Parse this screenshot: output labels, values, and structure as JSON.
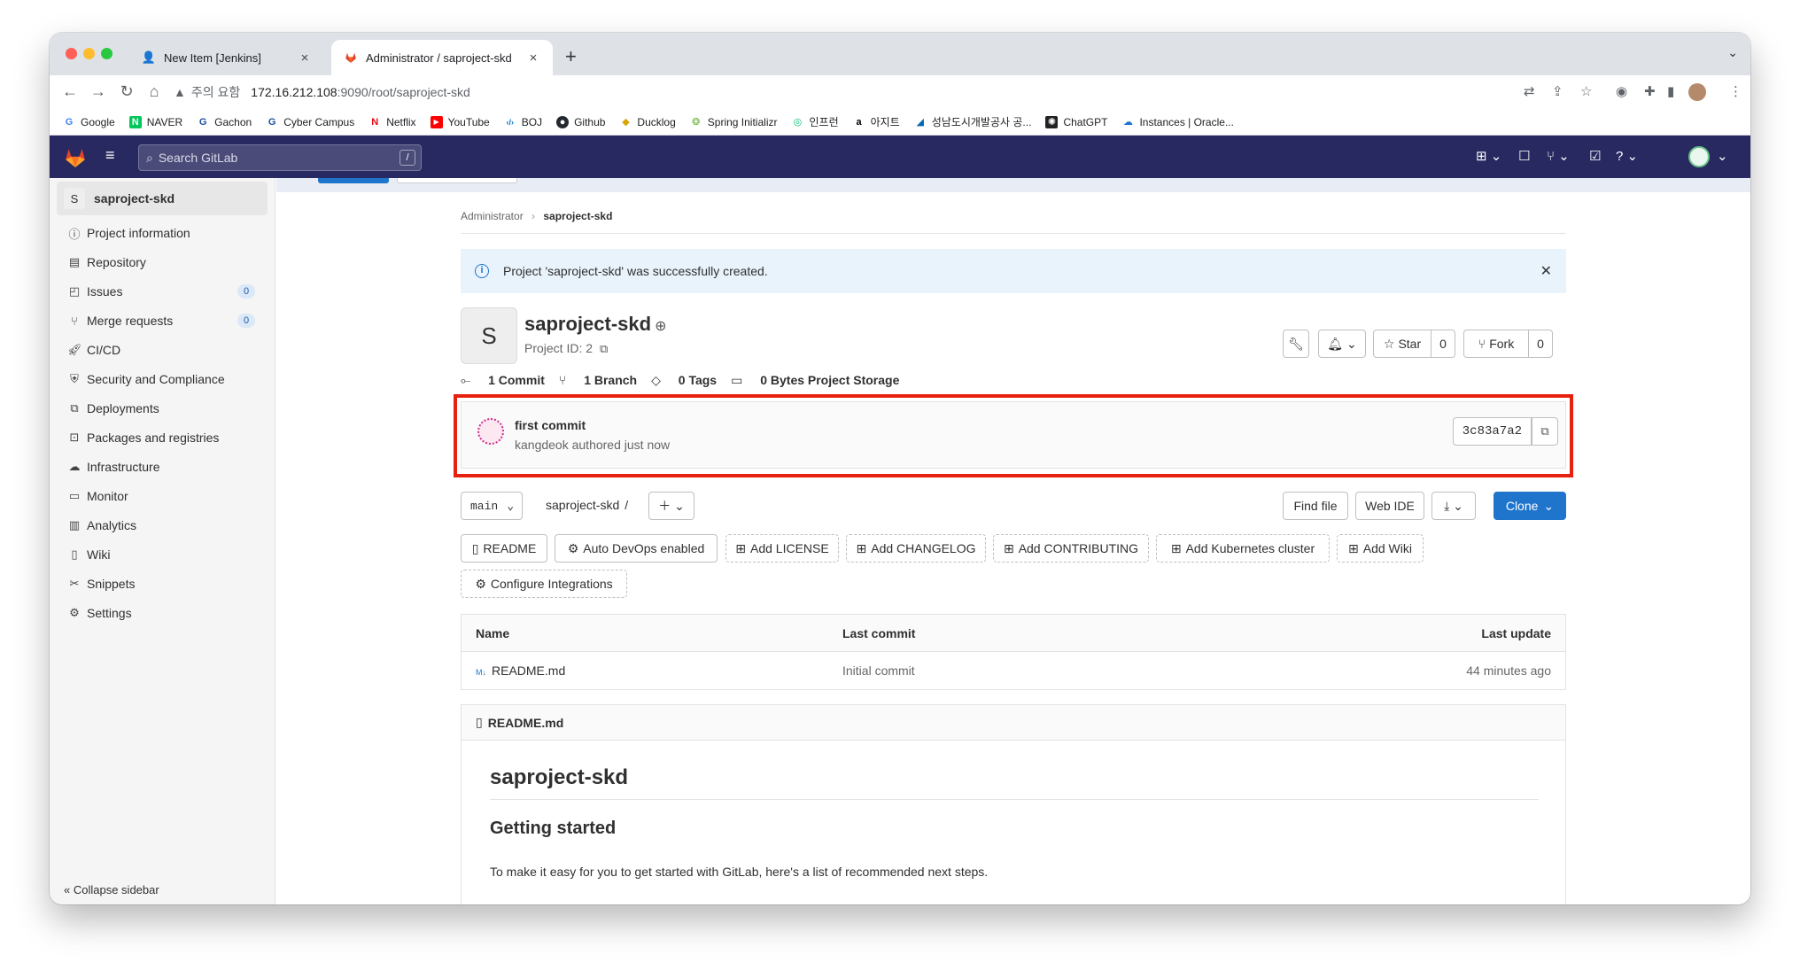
{
  "browser": {
    "tabs": [
      {
        "title": "New Item [Jenkins]",
        "active": false
      },
      {
        "title": "Administrator / saproject-skd",
        "active": true
      }
    ],
    "address": {
      "warning": "주의 요함",
      "host": "172.16.212.108",
      "path": ":9090/root/saproject-skd"
    },
    "bookmarks": [
      "Google",
      "NAVER",
      "Gachon",
      "Cyber Campus",
      "Netflix",
      "YouTube",
      "BOJ",
      "Github",
      "Ducklog",
      "Spring Initializr",
      "인프런",
      "아지트",
      "성남도시개발공사 공...",
      "ChatGPT",
      "Instances | Oracle..."
    ]
  },
  "gitlab": {
    "search_placeholder": "Search GitLab",
    "search_shortcut": "/"
  },
  "sidebar": {
    "project_initial": "S",
    "project_name": "saproject-skd",
    "items": [
      {
        "label": "Project information",
        "icon": "info-icon"
      },
      {
        "label": "Repository",
        "icon": "doc-icon"
      },
      {
        "label": "Issues",
        "icon": "issues-icon",
        "count": "0"
      },
      {
        "label": "Merge requests",
        "icon": "merge-icon",
        "count": "0"
      },
      {
        "label": "CI/CD",
        "icon": "rocket-icon"
      },
      {
        "label": "Security and Compliance",
        "icon": "shield-icon"
      },
      {
        "label": "Deployments",
        "icon": "deploy-icon"
      },
      {
        "label": "Packages and registries",
        "icon": "package-icon"
      },
      {
        "label": "Infrastructure",
        "icon": "cloud-icon"
      },
      {
        "label": "Monitor",
        "icon": "monitor-icon"
      },
      {
        "label": "Analytics",
        "icon": "chart-icon"
      },
      {
        "label": "Wiki",
        "icon": "book-icon"
      },
      {
        "label": "Snippets",
        "icon": "scissors-icon"
      },
      {
        "label": "Settings",
        "icon": "gear-icon"
      }
    ],
    "collapse": "Collapse sidebar"
  },
  "breadcrumb": {
    "parent": "Administrator",
    "current": "saproject-skd"
  },
  "alert": {
    "text": "Project 'saproject-skd' was successfully created."
  },
  "project": {
    "initial": "S",
    "name": "saproject-skd",
    "id_label": "Project ID: 2",
    "star_label": "Star",
    "star_count": "0",
    "fork_label": "Fork",
    "fork_count": "0",
    "stats": {
      "commits": "1 Commit",
      "branches": "1 Branch",
      "tags": "0 Tags",
      "storage": "0 Bytes Project Storage"
    }
  },
  "commit": {
    "title": "first commit",
    "author_line": "kangdeok authored just now",
    "sha": "3c83a7a2"
  },
  "repo_bar": {
    "branch": "main",
    "path": "saproject-skd",
    "path_sep": "/",
    "find_file": "Find file",
    "web_ide": "Web IDE",
    "clone": "Clone"
  },
  "quick_buttons": [
    "README",
    "Auto DevOps enabled",
    "Add LICENSE",
    "Add CHANGELOG",
    "Add CONTRIBUTING",
    "Add Kubernetes cluster",
    "Add Wiki",
    "Configure Integrations"
  ],
  "file_table": {
    "headers": {
      "name": "Name",
      "last_commit": "Last commit",
      "last_update": "Last update"
    },
    "rows": [
      {
        "name": "README.md",
        "commit": "Initial commit",
        "updated": "44 minutes ago"
      }
    ]
  },
  "readme": {
    "file": "README.md",
    "h1": "saproject-skd",
    "h2": "Getting started",
    "p": "To make it easy for you to get started with GitLab, here's a list of recommended next steps."
  },
  "colors": {
    "header": "#292961",
    "primary": "#1f75cb",
    "highlight": "#e8210f"
  }
}
